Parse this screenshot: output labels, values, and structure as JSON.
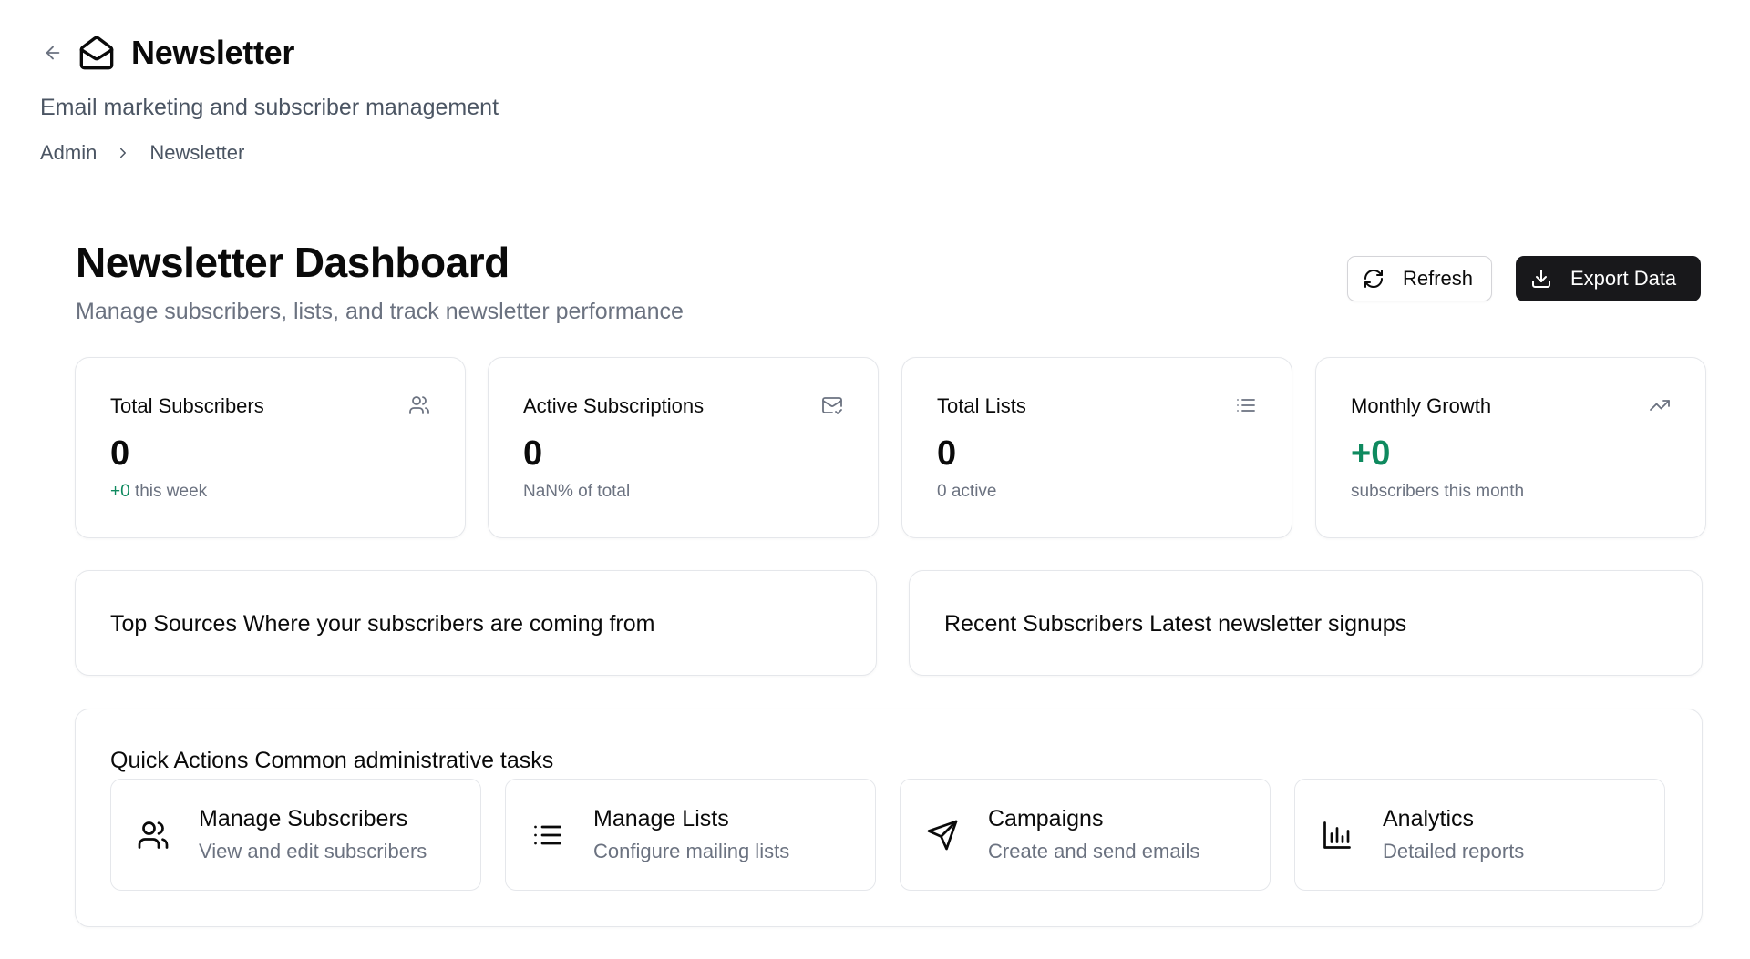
{
  "header": {
    "title": "Newsletter",
    "subtitle": "Email marketing and subscriber management",
    "breadcrumb": [
      {
        "label": "Admin"
      },
      {
        "label": "Newsletter"
      }
    ]
  },
  "dashboard": {
    "title": "Newsletter Dashboard",
    "subtitle": "Manage subscribers, lists, and track newsletter performance",
    "refresh_label": "Refresh",
    "export_label": "Export Data"
  },
  "stats": [
    {
      "label": "Total Subscribers",
      "value": "0",
      "note_prefix": "+0",
      "note": " this week",
      "icon": "users-icon"
    },
    {
      "label": "Active Subscriptions",
      "value": "0",
      "note": "NaN% of total",
      "icon": "mail-check-icon"
    },
    {
      "label": "Total Lists",
      "value": "0",
      "note": "0 active",
      "icon": "list-icon"
    },
    {
      "label": "Monthly Growth",
      "value": "+0",
      "note": "subscribers this month",
      "icon": "trending-up-icon"
    }
  ],
  "panels": {
    "top_sources": "Top Sources Where your subscribers are coming from",
    "recent_subscribers": "Recent Subscribers Latest newsletter signups"
  },
  "quick_actions": {
    "title": "Quick Actions Common administrative tasks",
    "items": [
      {
        "name": "Manage Subscribers",
        "desc": "View and edit subscribers",
        "icon": "users-icon"
      },
      {
        "name": "Manage Lists",
        "desc": "Configure mailing lists",
        "icon": "list-icon"
      },
      {
        "name": "Campaigns",
        "desc": "Create and send emails",
        "icon": "send-icon"
      },
      {
        "name": "Analytics",
        "desc": "Detailed reports",
        "icon": "bar-chart-icon"
      }
    ]
  },
  "colors": {
    "accent_green": "#0f8a5f",
    "button_dark": "#18181b",
    "border": "#e5e7eb",
    "muted_text": "#6b7280"
  }
}
